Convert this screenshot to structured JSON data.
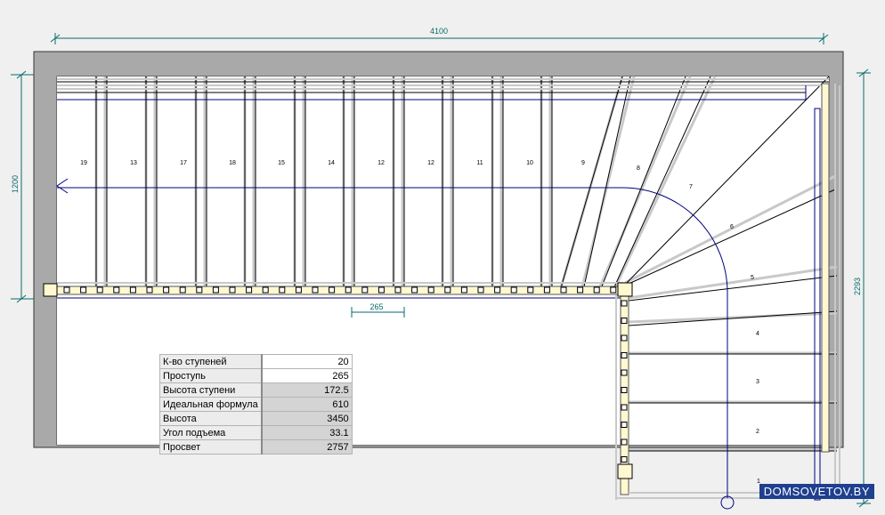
{
  "dimensions": {
    "top_width": "4100",
    "left_depth": "1200",
    "right_depth": "2293",
    "tread": "265"
  },
  "step_labels_top": [
    "19",
    "13",
    "17",
    "18",
    "15",
    "14",
    "12",
    "12",
    "11",
    "10",
    "9"
  ],
  "step_labels_winder": [
    "8",
    "7",
    "6",
    "5"
  ],
  "step_labels_right": [
    "4",
    "3",
    "2",
    "1"
  ],
  "parameters": [
    {
      "label": "К-во ступеней",
      "value": "20",
      "editable": true
    },
    {
      "label": "Проступь",
      "value": "265",
      "editable": true
    },
    {
      "label": "Высота ступени",
      "value": "172.5",
      "editable": false
    },
    {
      "label": "Идеальная формула",
      "value": "610",
      "editable": false
    },
    {
      "label": "Высота",
      "value": "3450",
      "editable": false
    },
    {
      "label": "Угол подъема",
      "value": "33.1",
      "editable": false
    },
    {
      "label": "Просвет",
      "value": "2757",
      "editable": false
    }
  ],
  "watermark": "DOMSOVETOV.BY",
  "colors": {
    "background": "#f0f0f0",
    "wall": "#a9a9a9",
    "dimension": "#0a6a6a",
    "walk_line": "#00007f",
    "stringer": "#fff8d0"
  }
}
